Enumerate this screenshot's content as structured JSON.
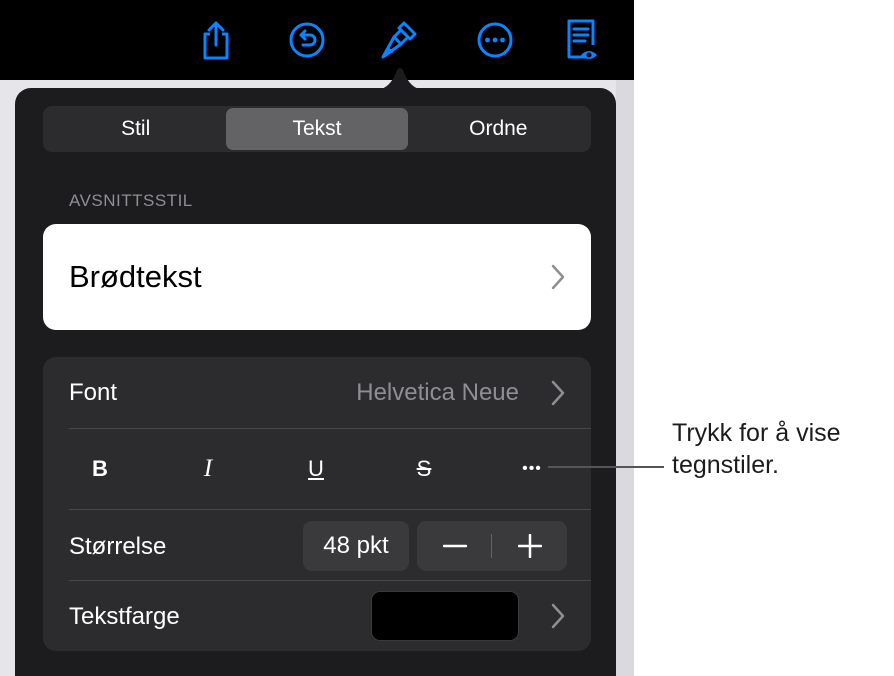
{
  "toolbar": {
    "icons": [
      "share-icon",
      "undo-icon",
      "format-brush-icon",
      "more-icon",
      "reader-view-icon"
    ],
    "accent_color": "#0a84ff"
  },
  "tabs": [
    {
      "label": "Stil",
      "active": false
    },
    {
      "label": "Tekst",
      "active": true
    },
    {
      "label": "Ordne",
      "active": false
    }
  ],
  "paragraph_style": {
    "section_label": "AVSNITTSSTIL",
    "value": "Brødtekst"
  },
  "font": {
    "label": "Font",
    "value": "Helvetica Neue"
  },
  "formatting": {
    "bold": "B",
    "italic": "I",
    "underline": "U",
    "strikethrough": "S",
    "more": "•••"
  },
  "size": {
    "label": "Størrelse",
    "value": "48 pkt"
  },
  "text_color": {
    "label": "Tekstfarge",
    "swatch_color": "#000000"
  },
  "callout": {
    "line1": "Trykk for å vise",
    "line2": "tegnstiler."
  }
}
